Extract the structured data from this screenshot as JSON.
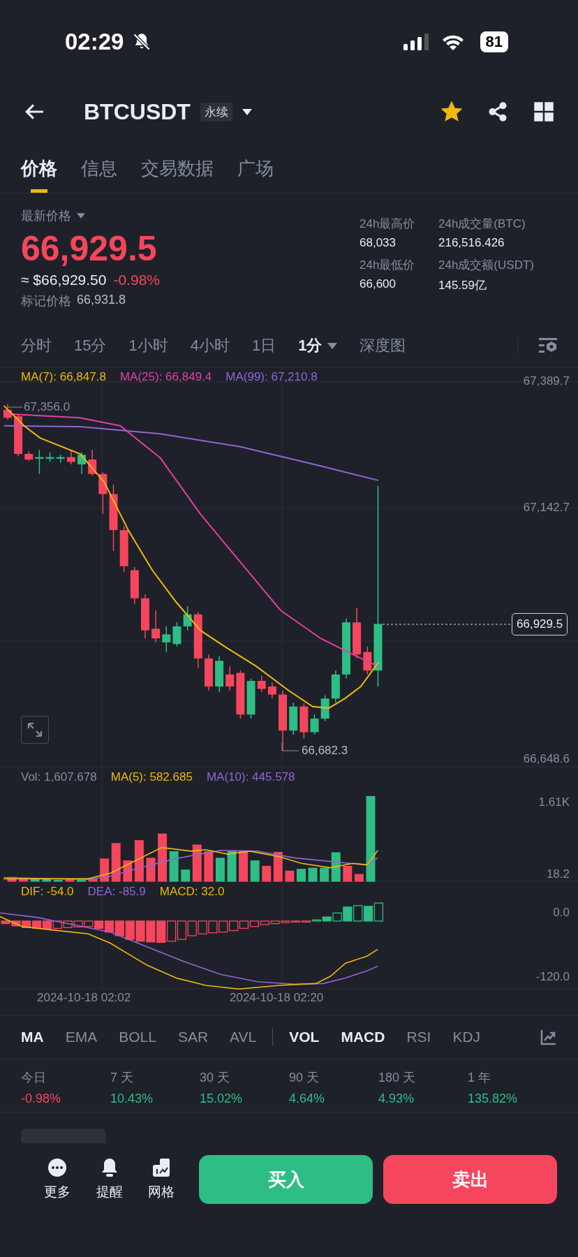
{
  "status_bar": {
    "time": "02:29",
    "battery": "81",
    "muted": true
  },
  "header": {
    "symbol": "BTCUSDT",
    "contract_tag": "永续",
    "favorite": true
  },
  "tabs": [
    {
      "label": "价格",
      "selected": true
    },
    {
      "label": "信息",
      "selected": false
    },
    {
      "label": "交易数据",
      "selected": false
    },
    {
      "label": "广场",
      "selected": false
    }
  ],
  "price": {
    "label": "最新价格",
    "last": "66,929.5",
    "color": "#f6465d",
    "usd": "≈ $66,929.50",
    "change": "-0.98%",
    "mark_label": "标记价格",
    "mark_value": "66,931.8"
  },
  "stats": [
    {
      "label": "24h最高价",
      "value": "68,033"
    },
    {
      "label": "24h成交量(BTC)",
      "value": "216,516.426"
    },
    {
      "label": "24h最低价",
      "value": "66,600"
    },
    {
      "label": "24h成交额(USDT)",
      "value": "145.59亿"
    }
  ],
  "intervals": [
    {
      "label": "分时",
      "selected": false,
      "dropdown": false
    },
    {
      "label": "15分",
      "selected": false,
      "dropdown": false
    },
    {
      "label": "1小时",
      "selected": false,
      "dropdown": false
    },
    {
      "label": "4小时",
      "selected": false,
      "dropdown": false
    },
    {
      "label": "1日",
      "selected": false,
      "dropdown": false
    },
    {
      "label": "1分",
      "selected": true,
      "dropdown": true
    },
    {
      "label": "深度图",
      "selected": false,
      "dropdown": false
    }
  ],
  "price_chart": {
    "legend": [
      {
        "text": "MA(7): 66,847.8",
        "color": "#f0b90b"
      },
      {
        "text": "MA(25): 66,849.4",
        "color": "#e23fa6"
      },
      {
        "text": "MA(99): 67,210.8",
        "color": "#9066d6"
      }
    ],
    "axis_labels": [
      "67,389.7",
      "67,142.7",
      "66,648.6"
    ],
    "high_label": "67,356.0",
    "low_label": "66,682.3",
    "current_price": "66,929.5"
  },
  "volume_chart": {
    "legend": [
      {
        "text": "Vol: 1,607.678",
        "color": "#848e9c"
      },
      {
        "text": "MA(5): 582.685",
        "color": "#f0b90b"
      },
      {
        "text": "MA(10): 445.578",
        "color": "#9066d6"
      }
    ],
    "axis_labels": [
      "1.61K",
      "18.2"
    ]
  },
  "macd_chart": {
    "legend": [
      {
        "text": "DIF: -54.0",
        "color": "#f0b90b"
      },
      {
        "text": "DEA: -85.9",
        "color": "#9066d6"
      },
      {
        "text": "MACD: 32.0",
        "color": "#e8b80d"
      }
    ],
    "axis_labels": [
      "0.0",
      "-120.0"
    ]
  },
  "time_axis": [
    "2024-10-18 02:02",
    "2024-10-18 02:20"
  ],
  "main_indicators": [
    {
      "label": "MA",
      "selected": true
    },
    {
      "label": "EMA",
      "selected": false
    },
    {
      "label": "BOLL",
      "selected": false
    },
    {
      "label": "SAR",
      "selected": false
    },
    {
      "label": "AVL",
      "selected": false
    }
  ],
  "sub_indicators": [
    {
      "label": "VOL",
      "selected": true
    },
    {
      "label": "MACD",
      "selected": true
    },
    {
      "label": "RSI",
      "selected": false
    },
    {
      "label": "KDJ",
      "selected": false
    }
  ],
  "performance": [
    {
      "period": "今日",
      "value": "-0.98%",
      "color": "#f6465d"
    },
    {
      "period": "7 天",
      "value": "10.43%",
      "color": "#2ebd85"
    },
    {
      "period": "30 天",
      "value": "15.02%",
      "color": "#2ebd85"
    },
    {
      "period": "90 天",
      "value": "4.64%",
      "color": "#2ebd85"
    },
    {
      "period": "180 天",
      "value": "4.93%",
      "color": "#2ebd85"
    },
    {
      "period": "1 年",
      "value": "135.82%",
      "color": "#2ebd85"
    }
  ],
  "actions": [
    {
      "label": "更多",
      "kind": "more"
    },
    {
      "label": "提醒",
      "kind": "alert"
    },
    {
      "label": "网格",
      "kind": "grid"
    }
  ],
  "buy_button": "买入",
  "sell_button": "卖出"
}
